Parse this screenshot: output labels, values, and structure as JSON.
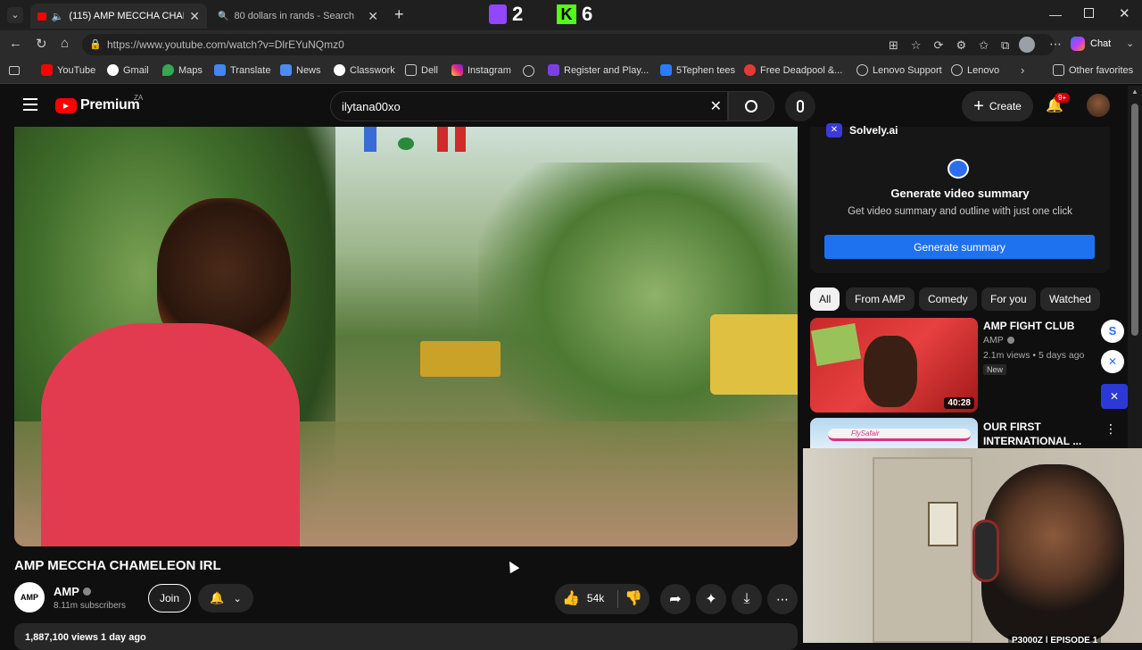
{
  "browser": {
    "tabs": [
      {
        "label": "(115) AMP MECCHA CHAMEL..."
      },
      {
        "label": "80 dollars in rands - Search"
      }
    ],
    "overlay_counts": {
      "twitch": "2",
      "kick": "6"
    },
    "url": "https://www.youtube.com/watch?v=DlrEYuNQmz0",
    "chat_label": "Chat",
    "favorites": [
      "YouTube",
      "Gmail",
      "Maps",
      "Translate",
      "News",
      "Classwork",
      "Dell",
      "Instagram",
      "Register and Play...",
      "5Tephen tees",
      "Free Deadpool &...",
      "Lenovo Support",
      "Lenovo"
    ],
    "other_favorites": "Other favorites"
  },
  "youtube": {
    "logo_text": "Premium",
    "region": "ZA",
    "search_value": "ilytana00xo",
    "create_label": "Create",
    "notif_badge": "9+"
  },
  "video": {
    "title": "AMP MECCHA CHAMELEON IRL",
    "channel": "AMP",
    "channel_logo_text": "AMP",
    "subscribers": "8.11m subscribers",
    "join_label": "Join",
    "likes": "54k",
    "views_date": "1,887,100 views  1 day ago"
  },
  "sidebar": {
    "solvely": {
      "brand": "Solvely.ai",
      "heading": "Generate video summary",
      "subtext": "Get video summary and outline with just one click",
      "button": "Generate summary"
    },
    "chips": [
      "All",
      "From AMP",
      "Comedy",
      "For you",
      "Watched"
    ],
    "recommendations": [
      {
        "title": "AMP FIGHT CLUB",
        "channel": "AMP",
        "meta": "2.1m views • 5 days ago",
        "badge": "New",
        "duration": "40:28"
      },
      {
        "title": "OUR FIRST INTERNATIONAL ...",
        "thumb_text": "FlySafair"
      }
    ]
  },
  "cam": {
    "caption": "P3000Z | EPISODE 1"
  }
}
